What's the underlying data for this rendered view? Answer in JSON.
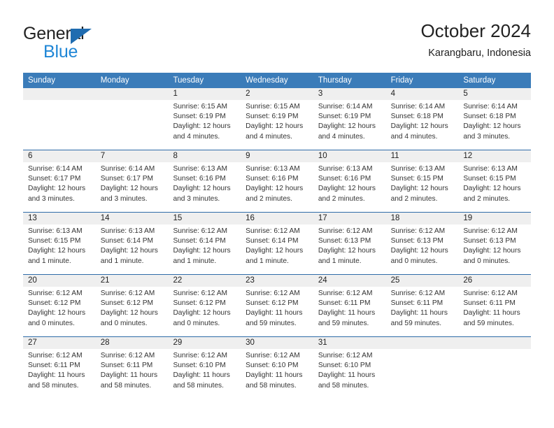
{
  "logo": {
    "word_one": "General",
    "word_two": "Blue",
    "triangle_icon": "blue-triangle-icon",
    "brand_blue": "#1f86d6",
    "triangle_blue": "#1f6cb0"
  },
  "header": {
    "title": "October 2024",
    "subtitle": "Karangbaru, Indonesia"
  },
  "theme": {
    "header_blue": "#3b7cb9",
    "row_divider_blue": "#2f6ca8",
    "date_strip_gray": "#efefef",
    "text_dark": "#222222"
  },
  "weekdays": [
    "Sunday",
    "Monday",
    "Tuesday",
    "Wednesday",
    "Thursday",
    "Friday",
    "Saturday"
  ],
  "weeks": [
    [
      {
        "date": "",
        "lines": []
      },
      {
        "date": "",
        "lines": []
      },
      {
        "date": "1",
        "lines": [
          "Sunrise: 6:15 AM",
          "Sunset: 6:19 PM",
          "Daylight: 12 hours",
          "and 4 minutes."
        ]
      },
      {
        "date": "2",
        "lines": [
          "Sunrise: 6:15 AM",
          "Sunset: 6:19 PM",
          "Daylight: 12 hours",
          "and 4 minutes."
        ]
      },
      {
        "date": "3",
        "lines": [
          "Sunrise: 6:14 AM",
          "Sunset: 6:19 PM",
          "Daylight: 12 hours",
          "and 4 minutes."
        ]
      },
      {
        "date": "4",
        "lines": [
          "Sunrise: 6:14 AM",
          "Sunset: 6:18 PM",
          "Daylight: 12 hours",
          "and 4 minutes."
        ]
      },
      {
        "date": "5",
        "lines": [
          "Sunrise: 6:14 AM",
          "Sunset: 6:18 PM",
          "Daylight: 12 hours",
          "and 3 minutes."
        ]
      }
    ],
    [
      {
        "date": "6",
        "lines": [
          "Sunrise: 6:14 AM",
          "Sunset: 6:17 PM",
          "Daylight: 12 hours",
          "and 3 minutes."
        ]
      },
      {
        "date": "7",
        "lines": [
          "Sunrise: 6:14 AM",
          "Sunset: 6:17 PM",
          "Daylight: 12 hours",
          "and 3 minutes."
        ]
      },
      {
        "date": "8",
        "lines": [
          "Sunrise: 6:13 AM",
          "Sunset: 6:16 PM",
          "Daylight: 12 hours",
          "and 3 minutes."
        ]
      },
      {
        "date": "9",
        "lines": [
          "Sunrise: 6:13 AM",
          "Sunset: 6:16 PM",
          "Daylight: 12 hours",
          "and 2 minutes."
        ]
      },
      {
        "date": "10",
        "lines": [
          "Sunrise: 6:13 AM",
          "Sunset: 6:16 PM",
          "Daylight: 12 hours",
          "and 2 minutes."
        ]
      },
      {
        "date": "11",
        "lines": [
          "Sunrise: 6:13 AM",
          "Sunset: 6:15 PM",
          "Daylight: 12 hours",
          "and 2 minutes."
        ]
      },
      {
        "date": "12",
        "lines": [
          "Sunrise: 6:13 AM",
          "Sunset: 6:15 PM",
          "Daylight: 12 hours",
          "and 2 minutes."
        ]
      }
    ],
    [
      {
        "date": "13",
        "lines": [
          "Sunrise: 6:13 AM",
          "Sunset: 6:15 PM",
          "Daylight: 12 hours",
          "and 1 minute."
        ]
      },
      {
        "date": "14",
        "lines": [
          "Sunrise: 6:13 AM",
          "Sunset: 6:14 PM",
          "Daylight: 12 hours",
          "and 1 minute."
        ]
      },
      {
        "date": "15",
        "lines": [
          "Sunrise: 6:12 AM",
          "Sunset: 6:14 PM",
          "Daylight: 12 hours",
          "and 1 minute."
        ]
      },
      {
        "date": "16",
        "lines": [
          "Sunrise: 6:12 AM",
          "Sunset: 6:14 PM",
          "Daylight: 12 hours",
          "and 1 minute."
        ]
      },
      {
        "date": "17",
        "lines": [
          "Sunrise: 6:12 AM",
          "Sunset: 6:13 PM",
          "Daylight: 12 hours",
          "and 1 minute."
        ]
      },
      {
        "date": "18",
        "lines": [
          "Sunrise: 6:12 AM",
          "Sunset: 6:13 PM",
          "Daylight: 12 hours",
          "and 0 minutes."
        ]
      },
      {
        "date": "19",
        "lines": [
          "Sunrise: 6:12 AM",
          "Sunset: 6:13 PM",
          "Daylight: 12 hours",
          "and 0 minutes."
        ]
      }
    ],
    [
      {
        "date": "20",
        "lines": [
          "Sunrise: 6:12 AM",
          "Sunset: 6:12 PM",
          "Daylight: 12 hours",
          "and 0 minutes."
        ]
      },
      {
        "date": "21",
        "lines": [
          "Sunrise: 6:12 AM",
          "Sunset: 6:12 PM",
          "Daylight: 12 hours",
          "and 0 minutes."
        ]
      },
      {
        "date": "22",
        "lines": [
          "Sunrise: 6:12 AM",
          "Sunset: 6:12 PM",
          "Daylight: 12 hours",
          "and 0 minutes."
        ]
      },
      {
        "date": "23",
        "lines": [
          "Sunrise: 6:12 AM",
          "Sunset: 6:12 PM",
          "Daylight: 11 hours",
          "and 59 minutes."
        ]
      },
      {
        "date": "24",
        "lines": [
          "Sunrise: 6:12 AM",
          "Sunset: 6:11 PM",
          "Daylight: 11 hours",
          "and 59 minutes."
        ]
      },
      {
        "date": "25",
        "lines": [
          "Sunrise: 6:12 AM",
          "Sunset: 6:11 PM",
          "Daylight: 11 hours",
          "and 59 minutes."
        ]
      },
      {
        "date": "26",
        "lines": [
          "Sunrise: 6:12 AM",
          "Sunset: 6:11 PM",
          "Daylight: 11 hours",
          "and 59 minutes."
        ]
      }
    ],
    [
      {
        "date": "27",
        "lines": [
          "Sunrise: 6:12 AM",
          "Sunset: 6:11 PM",
          "Daylight: 11 hours",
          "and 58 minutes."
        ]
      },
      {
        "date": "28",
        "lines": [
          "Sunrise: 6:12 AM",
          "Sunset: 6:11 PM",
          "Daylight: 11 hours",
          "and 58 minutes."
        ]
      },
      {
        "date": "29",
        "lines": [
          "Sunrise: 6:12 AM",
          "Sunset: 6:10 PM",
          "Daylight: 11 hours",
          "and 58 minutes."
        ]
      },
      {
        "date": "30",
        "lines": [
          "Sunrise: 6:12 AM",
          "Sunset: 6:10 PM",
          "Daylight: 11 hours",
          "and 58 minutes."
        ]
      },
      {
        "date": "31",
        "lines": [
          "Sunrise: 6:12 AM",
          "Sunset: 6:10 PM",
          "Daylight: 11 hours",
          "and 58 minutes."
        ]
      },
      {
        "date": "",
        "lines": []
      },
      {
        "date": "",
        "lines": []
      }
    ]
  ]
}
